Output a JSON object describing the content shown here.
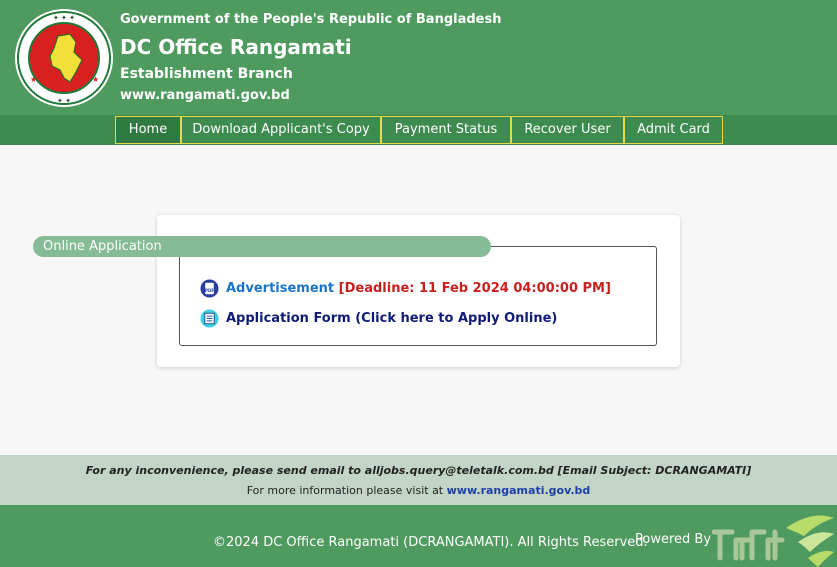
{
  "header": {
    "gov_line": "Government of the People's Republic of Bangladesh",
    "office_title": "DC Office Rangamati",
    "branch": "Establishment Branch",
    "website": "www.rangamati.gov.bd",
    "logo_icon": "bangladesh-government-seal-icon"
  },
  "nav": {
    "items": [
      {
        "label": "Home",
        "active": true
      },
      {
        "label": "Download Applicant's Copy"
      },
      {
        "label": "Payment Status"
      },
      {
        "label": "Recover User"
      },
      {
        "label": "Admit Card"
      }
    ]
  },
  "main": {
    "section_title": "Online Application",
    "advertisement_label": "Advertisement",
    "deadline_text": "[Deadline: 11 Feb 2024 04:00:00 PM]",
    "application_form_label": "Application Form (Click here to Apply Online)",
    "advertisement_icon": "pdf-icon",
    "application_icon": "form-icon"
  },
  "info": {
    "email_notice": "For any inconvenience, please send email to alljobs.query@teletalk.com.bd [Email Subject: DCRANGAMATI]",
    "more_info_prefix": "For more information please visit at",
    "more_info_link": "www.rangamati.gov.bd"
  },
  "footer": {
    "copyright": "©2024 DC Office Rangamati (DCRANGAMATI). All Rights Reserved.",
    "powered_by": "Powered By",
    "brand_logo": "teletalk-logo"
  },
  "colors": {
    "header_green": "#4f9a5f",
    "nav_green": "#3d8b4f",
    "nav_border": "#e7d84a",
    "legend_green": "#85bb95",
    "link_blue": "#1b74c9",
    "deadline_red": "#c91f1f",
    "form_navy": "#101c74"
  }
}
